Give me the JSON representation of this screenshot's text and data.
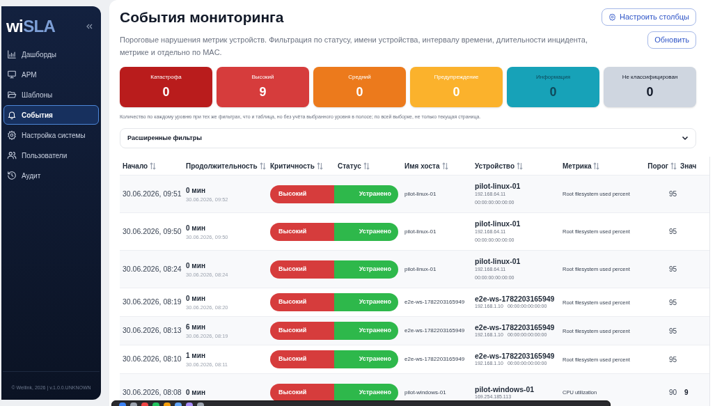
{
  "sidebar": {
    "logo": {
      "prefix": "wi",
      "rest": "SLA"
    },
    "items": [
      {
        "label": "Дашборды",
        "kind": "chart",
        "selected": false
      },
      {
        "label": "АРМ",
        "kind": "monitor",
        "selected": false
      },
      {
        "label": "Шаблоны",
        "kind": "folder",
        "selected": false
      },
      {
        "label": "События",
        "kind": "bell",
        "selected": true
      },
      {
        "label": "Настройка системы",
        "kind": "gear",
        "selected": false
      },
      {
        "label": "Пользователи",
        "kind": "users",
        "selected": false
      },
      {
        "label": "Аудит",
        "kind": "history",
        "selected": false
      }
    ],
    "footer": "© Wellink, 2026 | v.1.0.0.UNKNOWN"
  },
  "header": {
    "title": "События мониторинга",
    "description": "Пороговые нарушения метрик устройств. Фильтрация по статусу, имени устройства, интервалу времени, длительности инцидента, метрике и отдельно по MAC.",
    "buttons": [
      {
        "label": "Настроить столбцы",
        "kind": "settings"
      },
      {
        "label": "Обновить",
        "kind": "refresh"
      }
    ]
  },
  "severity_cards": [
    {
      "label": "Катастрофа",
      "count": "0",
      "color": "#b91c1c"
    },
    {
      "label": "Высокий",
      "count": "9",
      "color": "#d63c3c"
    },
    {
      "label": "Средний",
      "count": "0",
      "color": "#ec7a1c"
    },
    {
      "label": "Предупреждение",
      "count": "0",
      "color": "#fbb22c"
    },
    {
      "label": "Информация",
      "count": "0",
      "color": "#17a2b8"
    },
    {
      "label": "Не классифицирован",
      "count": "0",
      "color": "#cfd6e0"
    }
  ],
  "cards_note": "Количество по каждому уровню при тех же фильтрах, что и таблица, но без учёта выбранного уровня в полосе; по всей выборке, не только текущая страница.",
  "filters": {
    "label": "Расширенные фильтры",
    "expanded": false
  },
  "table": {
    "columns": [
      "Начало",
      "Продолжительность",
      "Критичность",
      "Статус",
      "Имя хоста",
      "Устройство",
      "Метрика",
      "Порог",
      "Знач"
    ],
    "rows": [
      {
        "kind": "stacked",
        "start": "30.06.2026, 09:51",
        "duration": "0 мин",
        "end": "30.06.2026, 09:52",
        "severity": "Высокий",
        "status": "Устранено",
        "host": "pilot-linux-01",
        "device": "pilot-linux-01",
        "ip": "192.168.64.11",
        "mac": "00:00:00:00:00:00",
        "metric": "Root filesystem used percent",
        "threshold": "95"
      },
      {
        "kind": "stacked",
        "start": "30.06.2026, 09:50",
        "duration": "0 мин",
        "end": "30.06.2026, 09:50",
        "severity": "Высокий",
        "status": "Устранено",
        "host": "pilot-linux-01",
        "device": "pilot-linux-01",
        "ip": "192.168.64.11",
        "mac": "00:00:00:00:00:00",
        "metric": "Root filesystem used percent",
        "threshold": "95"
      },
      {
        "kind": "stacked",
        "start": "30.06.2026, 08:24",
        "duration": "0 мин",
        "end": "30.06.2026, 08:24",
        "severity": "Высокий",
        "status": "Устранено",
        "host": "pilot-linux-01",
        "device": "pilot-linux-01",
        "ip": "192.168.64.11",
        "mac": "00:00:00:00:00:00",
        "metric": "Root filesystem used percent",
        "threshold": "95"
      },
      {
        "kind": "inline",
        "start": "30.06.2026, 08:19",
        "duration": "0 мин",
        "end": "30.06.2026, 08:20",
        "severity": "Высокий",
        "status": "Устранено",
        "host": "e2e-ws-1782203165949",
        "device": "e2e-ws-1782203165949",
        "ip": "192.168.1.10",
        "mac": "00:00:00:00:00:00",
        "metric": "Root filesystem used percent",
        "threshold": "95"
      },
      {
        "kind": "inline",
        "start": "30.06.2026, 08:13",
        "duration": "6 мин",
        "end": "30.06.2026, 08:19",
        "severity": "Высокий",
        "status": "Устранено",
        "host": "e2e-ws-1782203165949",
        "device": "e2e-ws-1782203165949",
        "ip": "192.168.1.10",
        "mac": "00:00:00:00:00:00",
        "metric": "Root filesystem used percent",
        "threshold": "95"
      },
      {
        "kind": "inline",
        "start": "30.06.2026, 08:10",
        "duration": "1 мин",
        "end": "30.06.2026, 08:11",
        "severity": "Высокий",
        "status": "Устранено",
        "host": "e2e-ws-1782203165949",
        "device": "e2e-ws-1782203165949",
        "ip": "192.168.1.10",
        "mac": "00:00:00:00:00:00",
        "metric": "Root filesystem used percent",
        "threshold": "95"
      },
      {
        "kind": "partial",
        "start": "30.06.2026, 08:08",
        "duration": "0 мин",
        "severity": "Высокий",
        "status": "Устранено",
        "host": "pilot-windows-01",
        "device": "pilot-windows-01",
        "ip": "169.254.185.113",
        "metric": "CPU utilization",
        "threshold": "90",
        "value": "9"
      }
    ]
  }
}
